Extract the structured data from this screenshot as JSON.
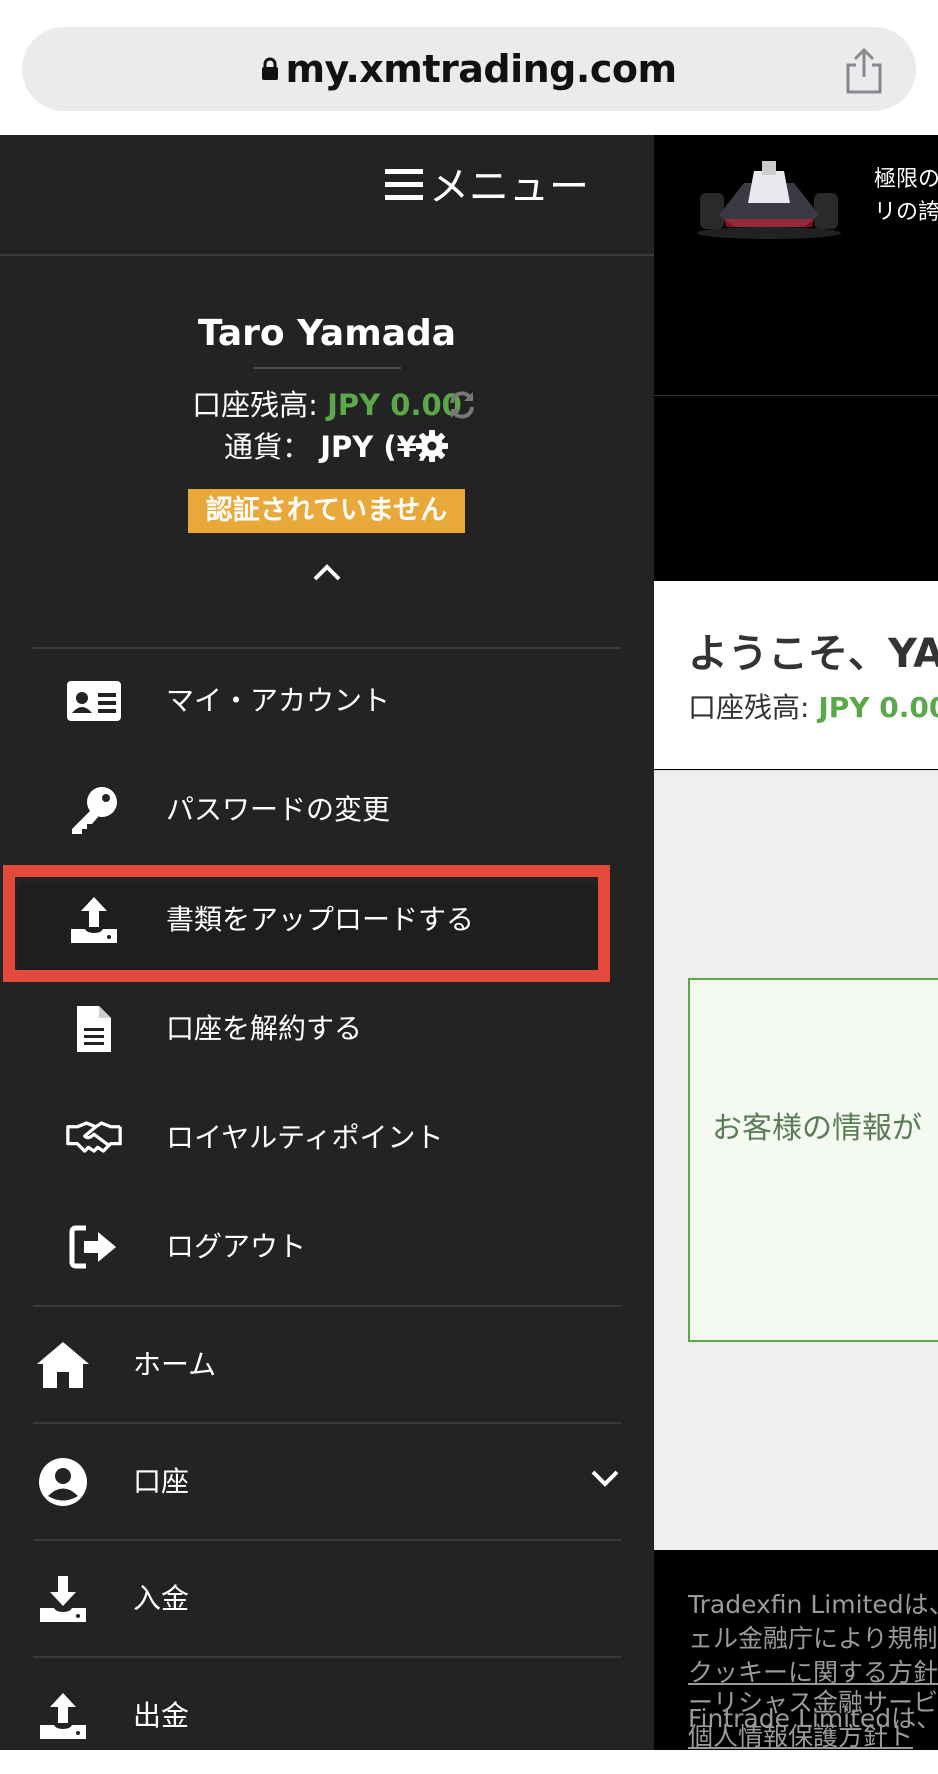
{
  "browser": {
    "url": "my.xmtrading.com"
  },
  "background_page": {
    "promo_text_line1": "極限の",
    "promo_text_line2": "リの誇",
    "welcome_title": "ようこそ、YAMA",
    "welcome_balance_label": "口座残高: ",
    "welcome_balance_value": "JPY 0.00",
    "info_text": "お客様の情報が",
    "footer_line1": "Tradexfin Limitedは、",
    "footer_line2": "ェル金融庁により規制",
    "footer_line3": "クッキーに関する方針",
    "footer_line4": "Fintrade Limitedは、",
    "footer_line5": "ーリシャス金融サービ",
    "footer_line6": "個人情報保護方針ト"
  },
  "menu": {
    "title": "メニュー",
    "user_name": "Taro Yamada",
    "balance_label": "口座残高: ",
    "balance_value": "JPY 0.00",
    "currency_label": "通貨： ",
    "currency_value": "JPY (¥)",
    "status_badge": "認証されていません",
    "account_items": [
      {
        "label": "マイ・アカウント",
        "icon": "id-card-icon"
      },
      {
        "label": "パスワードの変更",
        "icon": "key-icon"
      },
      {
        "label": "書類をアップロードする",
        "icon": "upload-icon"
      },
      {
        "label": "口座を解約する",
        "icon": "document-icon"
      },
      {
        "label": "ロイヤルティポイント",
        "icon": "handshake-icon"
      },
      {
        "label": "ログアウト",
        "icon": "logout-icon"
      }
    ],
    "nav_items": [
      {
        "label": "ホーム",
        "icon": "home-icon"
      },
      {
        "label": "口座",
        "icon": "user-circle-icon"
      },
      {
        "label": "入金",
        "icon": "download-icon"
      },
      {
        "label": "出金",
        "icon": "upload-icon"
      }
    ]
  },
  "colors": {
    "menu_bg": "#232323",
    "balance_green": "#5aa84a",
    "badge_orange": "#e8a93a",
    "highlight_red": "#e34a3c"
  }
}
